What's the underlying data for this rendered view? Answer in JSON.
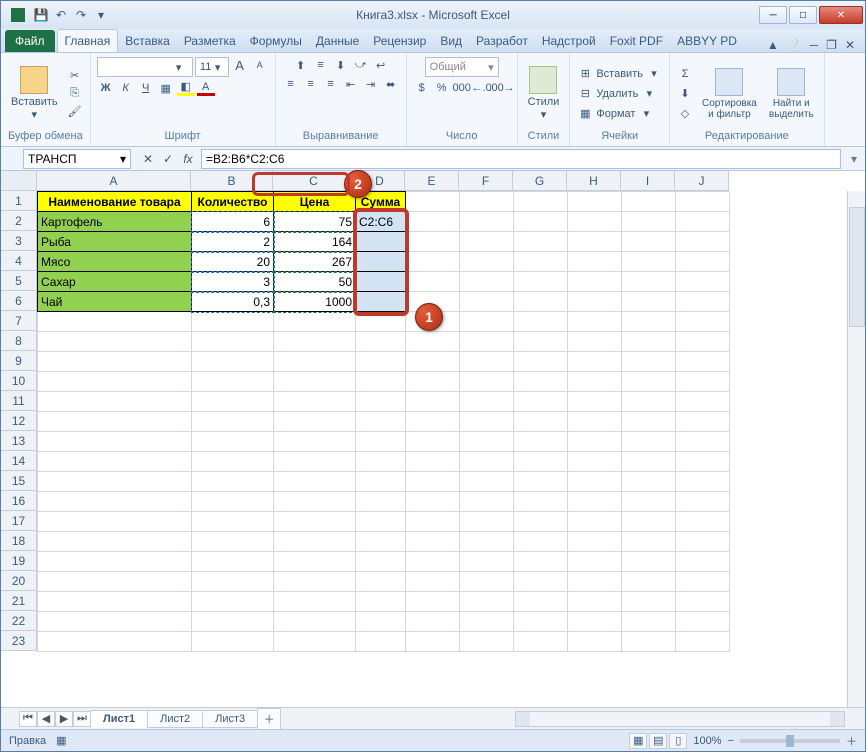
{
  "title": "Книга3.xlsx - Microsoft Excel",
  "qat": {
    "save": "💾",
    "undo": "↶",
    "redo": "↷",
    "dd": "▾"
  },
  "win": {
    "min": "─",
    "max": "□",
    "close": "✕"
  },
  "tabs": {
    "file": "Файл",
    "items": [
      "Главная",
      "Вставка",
      "Разметка",
      "Формулы",
      "Данные",
      "Рецензир",
      "Вид",
      "Разработ",
      "Надстрой",
      "Foxit PDF",
      "ABBYY PD"
    ],
    "active": 0
  },
  "ribbon": {
    "clipboard": {
      "paste": "Вставить",
      "label": "Буфер обмена",
      "cut_icon": "✂",
      "copy_icon": "⎘",
      "brush_icon": "🖌"
    },
    "font": {
      "label": "Шрифт",
      "name_placeholder": "",
      "size_placeholder": "11",
      "bold": "Ж",
      "italic": "К",
      "underline": "Ч",
      "grow": "A",
      "shrink": "A",
      "border": "▦",
      "fill": "◧",
      "color": "A"
    },
    "align": {
      "label": "Выравнивание",
      "top": "⬆",
      "mid": "≡",
      "bot": "⬇",
      "left": "≡",
      "center": "≡",
      "right": "≡",
      "wrap": "↩",
      "merge": "⬌",
      "indentL": "⇤",
      "indentR": "⇥",
      "orient": "⤻"
    },
    "number": {
      "label": "Число",
      "format": "Общий",
      "pct": "%",
      "comma": "000",
      "cur": "$",
      "inc": "←.0",
      "dec": ".00→"
    },
    "styles": {
      "label": "Стили",
      "btn": "Стили",
      "cond_icon": "▦"
    },
    "cells": {
      "label": "Ячейки",
      "insert": "Вставить",
      "delete": "Удалить",
      "format": "Формат"
    },
    "editing": {
      "label": "Редактирование",
      "sum": "Σ",
      "fill": "⬇",
      "clear": "◇",
      "sort": "Сортировка\nи фильтр",
      "find": "Найти и\nвыделить"
    }
  },
  "fx": {
    "namebox": "ТРАНСП",
    "cancel": "✕",
    "enter": "✓",
    "fx": "fx",
    "formula": "=B2:B6*C2:C6"
  },
  "colwidths": {
    "A": 154,
    "B": 82,
    "C": 82,
    "D": 50,
    "rest": 54
  },
  "columns": [
    "A",
    "B",
    "C",
    "D",
    "E",
    "F",
    "G",
    "H",
    "I",
    "J"
  ],
  "rows_visible": 23,
  "headers": {
    "A": "Наименование товара",
    "B": "Количество",
    "C": "Цена",
    "D": "Сумма"
  },
  "d2_text": "C2:C6",
  "data_rows": [
    {
      "name": "Картофель",
      "qty": "6",
      "price": "75"
    },
    {
      "name": "Рыба",
      "qty": "2",
      "price": "164"
    },
    {
      "name": "Мясо",
      "qty": "20",
      "price": "267"
    },
    {
      "name": "Сахар",
      "qty": "3",
      "price": "50"
    },
    {
      "name": "Чай",
      "qty": "0,3",
      "price": "1000"
    }
  ],
  "sheets": {
    "items": [
      "Лист1",
      "Лист2",
      "Лист3"
    ],
    "active": 0,
    "nav": [
      "⏮",
      "◀",
      "▶",
      "⏭"
    ],
    "add": "＋"
  },
  "status": {
    "mode": "Правка",
    "macro_icon": "▦",
    "zoom": "100%",
    "minus": "−",
    "plus": "＋"
  },
  "callouts": {
    "one": "1",
    "two": "2"
  },
  "chart_data": {
    "type": "table",
    "headers": [
      "Наименование товара",
      "Количество",
      "Цена",
      "Сумма"
    ],
    "rows": [
      [
        "Картофель",
        6,
        75,
        null
      ],
      [
        "Рыба",
        2,
        164,
        null
      ],
      [
        "Мясо",
        20,
        267,
        null
      ],
      [
        "Сахар",
        3,
        50,
        null
      ],
      [
        "Чай",
        0.3,
        1000,
        null
      ]
    ],
    "formula_D": "=B2:B6*C2:C6"
  }
}
